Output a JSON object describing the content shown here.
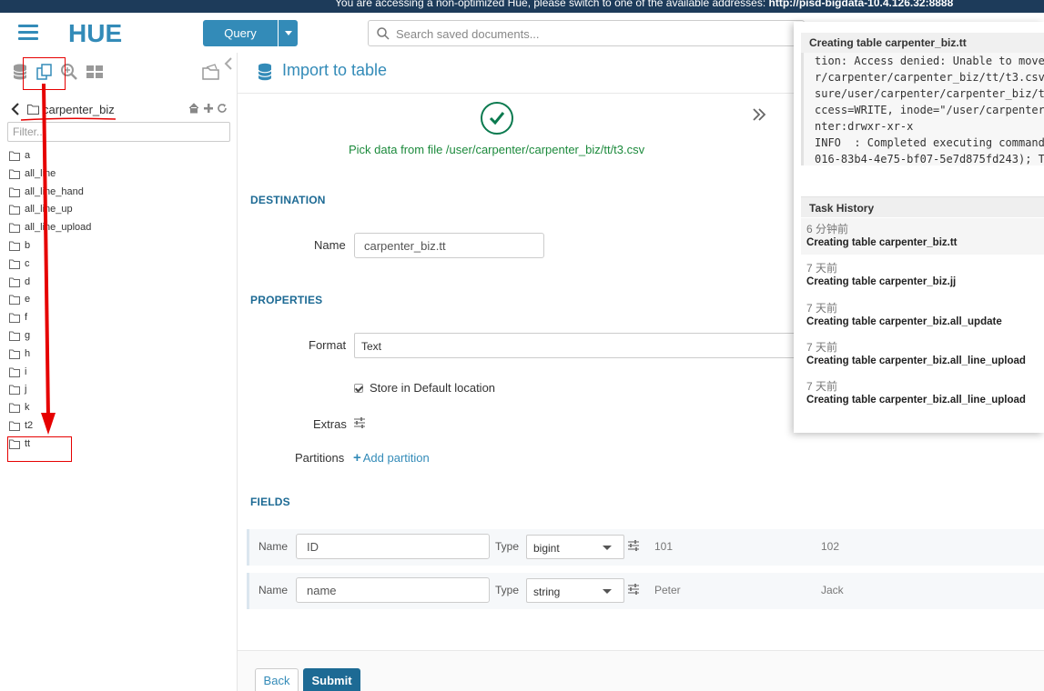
{
  "banner": {
    "text": "You are accessing a non-optimized Hue, please switch to one of the available addresses:",
    "link": "http://pisd-bigdata-10.4.126.32:8888"
  },
  "header": {
    "logo_text": "HUE",
    "query_label": "Query",
    "search_placeholder": "Search saved documents..."
  },
  "leftpanel": {
    "breadcrumb": "carpenter_biz",
    "filter_placeholder": "Filter...",
    "items": [
      "a",
      "all_line",
      "all_line_hand",
      "all_line_up",
      "all_line_upload",
      "b",
      "c",
      "d",
      "e",
      "f",
      "g",
      "h",
      "i",
      "j",
      "k",
      "t2",
      "tt"
    ]
  },
  "main": {
    "title": "Import to table",
    "step_text": "Pick data from file /user/carpenter/carpenter_biz/tt/t3.csv",
    "destination": {
      "section": "DESTINATION",
      "name_label": "Name",
      "name_value": "carpenter_biz.tt"
    },
    "properties": {
      "section": "PROPERTIES",
      "format_label": "Format",
      "format_value": "Text",
      "store_label": "Store in Default location",
      "extras_label": "Extras",
      "partitions_label": "Partitions",
      "add_partition": "Add partition"
    },
    "fields": {
      "section": "FIELDS",
      "name_label": "Name",
      "type_label": "Type",
      "rows": [
        {
          "name": "ID",
          "type": "bigint",
          "sample1": "101",
          "sample2": "102"
        },
        {
          "name": "name",
          "type": "string",
          "sample1": "Peter",
          "sample2": "Jack"
        }
      ]
    },
    "buttons": {
      "back": "Back",
      "submit": "Submit"
    }
  },
  "job_popup": {
    "title": "Creating table carpenter_biz.tt",
    "log_lines": [
      "tion: Access denied: Unable to move",
      "r/carpenter/carpenter_biz/tt/t3.csv",
      "sure/user/carpenter/carpenter_biz/t",
      "ccess=WRITE, inode=\"/user/carpenter",
      "nter:drwxr-xr-x",
      "INFO  : Completed executing command",
      "016-83b4-4e75-bf07-5e7d875fd243); T"
    ],
    "history_title": "Task History",
    "history": [
      {
        "time": "6 分钟前",
        "title": "Creating table carpenter_biz.tt"
      },
      {
        "time": "7 天前",
        "title": "Creating table carpenter_biz.jj"
      },
      {
        "time": "7 天前",
        "title": "Creating table carpenter_biz.all_update"
      },
      {
        "time": "7 天前",
        "title": "Creating table carpenter_biz.all_line_upload"
      },
      {
        "time": "7 天前",
        "title": "Creating table carpenter_biz.all_line_upload"
      }
    ]
  },
  "colors": {
    "accent": "#338bb8",
    "section": "#1d6a94",
    "success": "#1c8a3c",
    "annotation": "#e60000"
  }
}
